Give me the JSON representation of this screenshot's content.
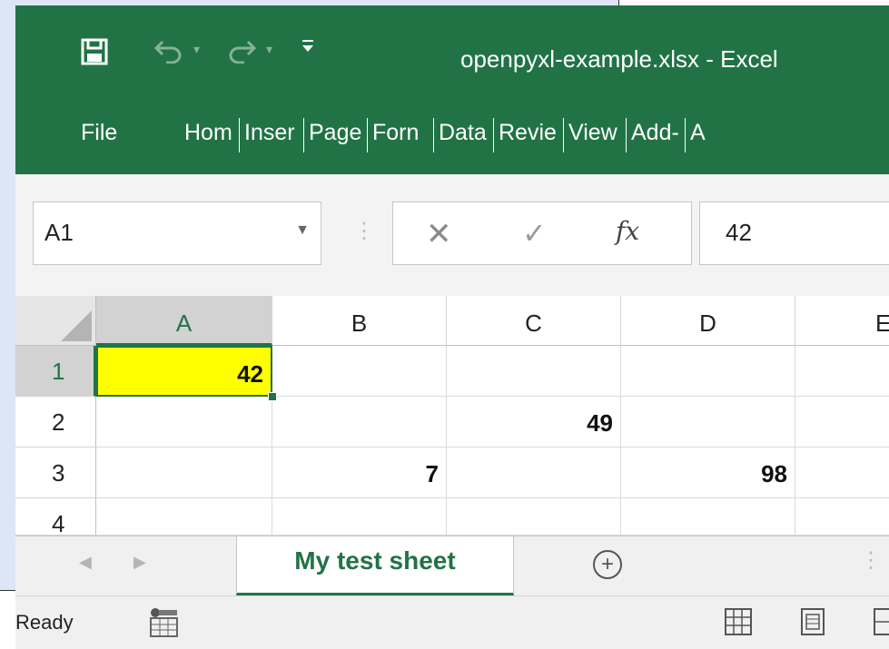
{
  "app": {
    "title": "openpyxl-example.xlsx - Excel"
  },
  "ribbon": {
    "tabs": [
      "File",
      "Hom",
      "Inser",
      "Page",
      "Forn",
      "Data",
      "Revie",
      "View",
      "Add-",
      "A"
    ]
  },
  "formula_bar": {
    "name_box": "A1",
    "fx_label": "fx",
    "value": "42"
  },
  "grid": {
    "columns": [
      "A",
      "B",
      "C",
      "D",
      "E"
    ],
    "rows": [
      "1",
      "2",
      "3",
      "4"
    ],
    "cells": {
      "A1": "42",
      "C2": "49",
      "B3": "7",
      "D3": "98"
    },
    "selected_cell": "A1",
    "selected_fill": "#ffff00"
  },
  "sheet_tabs": {
    "active": "My test sheet",
    "add_symbol": "+"
  },
  "status_bar": {
    "text": "Ready"
  },
  "colors": {
    "accent": "#217346"
  }
}
